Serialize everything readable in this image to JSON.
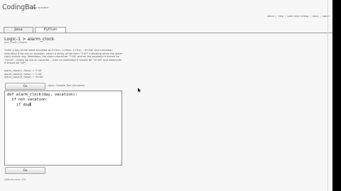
{
  "app": {
    "logo": "CodingBat",
    "logo_subtitle": "code practice"
  },
  "topnav": {
    "items": [
      "about",
      "help",
      "code help+videos",
      "done",
      "report"
    ],
    "separator": "|"
  },
  "tabs": [
    {
      "label": "Java",
      "selected": false
    },
    {
      "label": "Python",
      "selected": true
    }
  ],
  "problem": {
    "title": "Logic-1 > alarm_clock",
    "breadcrumbs": [
      "prev",
      "next",
      "chance"
    ],
    "breadcrumb_separator": "|",
    "description": "Given a day of the week encoded as 0=Sun, 1=Mon, 2=Tue, ...6=Sat, and a boolean indicating if we are on vacation, return a string of the form \"7:00\" indicating when the alarm clock should ring. Weekdays, the alarm should be \"7:00\" and on the weekend it should be \"10:00\". Unless we are on vacation -- then on weekdays it should be \"10:00\" and weekends it should be \"off\".",
    "examples": [
      "alarm_clock(1, False) → '7:00'",
      "alarm_clock(5, False) → '7:00'",
      "alarm_clock(0, False) → '10:00'"
    ]
  },
  "buttons": {
    "go_top": "Go",
    "go_bottom": "Go"
  },
  "hint_text": "...Save, Compile, Run (ctrl-enter)",
  "editor": {
    "lines": [
      "def alarm_clock(day, vacation):",
      "  if not vacation:",
      "    if day"
    ]
  },
  "footer_text": "Difficulty dots: 220"
}
